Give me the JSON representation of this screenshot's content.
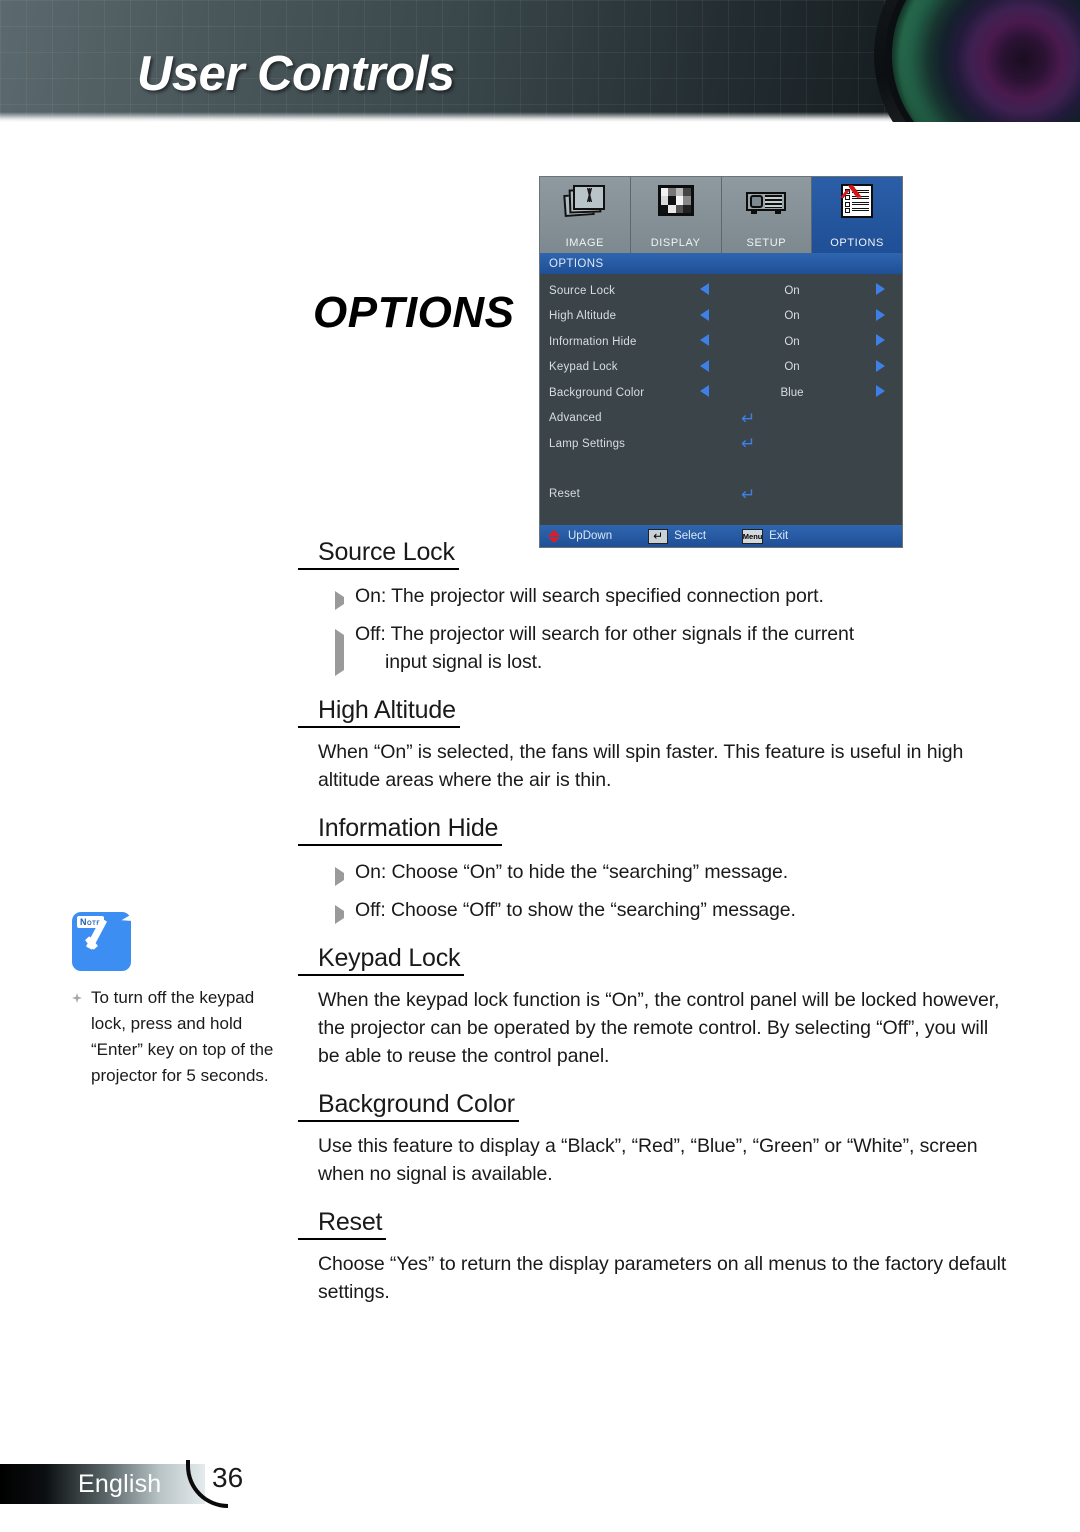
{
  "header": {
    "title": "User Controls",
    "lens_icon": "camera-lens-graphic"
  },
  "page_label": "OPTIONS",
  "osd": {
    "tabs": [
      {
        "label": "IMAGE",
        "icon": "image-stack-icon",
        "active": false
      },
      {
        "label": "DISPLAY",
        "icon": "checkerboard-icon",
        "active": false
      },
      {
        "label": "SETUP",
        "icon": "projector-icon",
        "active": false
      },
      {
        "label": "OPTIONS",
        "icon": "checklist-icon",
        "active": true
      }
    ],
    "title": "OPTIONS",
    "rows": [
      {
        "label": "Source Lock",
        "value": "On",
        "type": "select"
      },
      {
        "label": "High Altitude",
        "value": "On",
        "type": "select"
      },
      {
        "label": "Information Hide",
        "value": "On",
        "type": "select"
      },
      {
        "label": "Keypad Lock",
        "value": "On",
        "type": "select"
      },
      {
        "label": "Background Color",
        "value": "Blue",
        "type": "select"
      },
      {
        "label": "Advanced",
        "value": "",
        "type": "enter"
      },
      {
        "label": "Lamp Settings",
        "value": "",
        "type": "enter"
      },
      {
        "label": "Reset",
        "value": "",
        "type": "enter"
      }
    ],
    "footer": {
      "updown_label": "UpDown",
      "select_label": "Select",
      "select_key": "↵",
      "exit_label": "Exit",
      "exit_key": "Menu"
    },
    "colors": {
      "panel_bg": "#3a4449",
      "titlebar_blue": "#1f4f96",
      "arrow_blue": "#3f7fe8",
      "tab_grey": "#8e9a9f",
      "updown_red": "#d81f27"
    }
  },
  "sections": [
    {
      "heading": "Source Lock",
      "paragraph": "",
      "bullets": [
        {
          "text": "On: The projector will search specified connection port.",
          "continuation": ""
        },
        {
          "text": "Off: The projector will search for other signals if the current",
          "continuation": "input signal is lost."
        }
      ]
    },
    {
      "heading": "High Altitude",
      "paragraph": "When “On” is selected, the fans will spin faster. This feature is useful in high altitude areas where the air is thin.",
      "bullets": []
    },
    {
      "heading": "Information Hide",
      "paragraph": "",
      "bullets": [
        {
          "text": "On: Choose “On” to hide the “searching” message.",
          "continuation": ""
        },
        {
          "text": "Off: Choose “Off” to show the “searching” message.",
          "continuation": ""
        }
      ]
    },
    {
      "heading": "Keypad Lock",
      "paragraph": "When the keypad lock function is “On”, the control panel will be locked however, the projector can be operated by the remote control. By selecting “Off”, you will be able to reuse the control panel.",
      "bullets": []
    },
    {
      "heading": "Background Color",
      "paragraph": "Use this feature to display a “Black”, “Red”, “Blue”, “Green” or “White”, screen when no signal is available.",
      "bullets": []
    },
    {
      "heading": "Reset",
      "paragraph": "Choose “Yes” to return the display parameters on all menus to the factory default settings.",
      "bullets": []
    }
  ],
  "note": {
    "badge": "Note",
    "icon": "blue-checkmark-note-icon",
    "text": "To turn off the keypad lock, press and hold “Enter” key on top of the projector for 5 seconds."
  },
  "footer": {
    "language": "English",
    "page_number": "36"
  }
}
